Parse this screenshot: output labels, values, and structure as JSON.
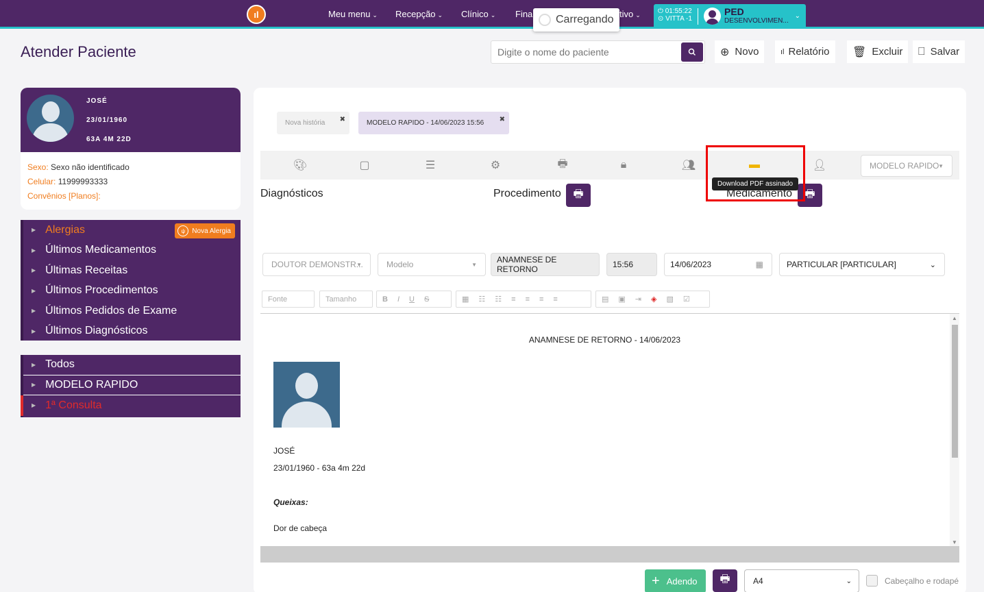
{
  "nav": {
    "items": [
      {
        "label": "Meu menu"
      },
      {
        "label": "Recepção"
      },
      {
        "label": "Clínico"
      },
      {
        "label": "Finan"
      },
      {
        "label": "tivo"
      }
    ],
    "loading": "Carregando",
    "session": {
      "time": "01:55:22",
      "location": "VITTA -1",
      "name": "PED",
      "subtitle": "DESENVOLVIMEN..."
    }
  },
  "header": {
    "title": "Atender Paciente",
    "search_placeholder": "Digite o nome do paciente",
    "novo": "Novo",
    "relatorio": "Relatório",
    "excluir": "Excluir",
    "salvar": "Salvar"
  },
  "patient": {
    "name": "JOSÉ",
    "birth": "23/01/1960",
    "age": "63A 4M 22D",
    "sexo_label": "Sexo:",
    "sexo_value": "Sexo não identificado",
    "celular_label": "Celular:",
    "celular_value": "11999993333",
    "convenios_label": "Convênios [Planos]:"
  },
  "history_panel": {
    "items": [
      {
        "label": "Alergias"
      },
      {
        "label": "Últimos Medicamentos"
      },
      {
        "label": "Últimas Receitas"
      },
      {
        "label": "Últimos Procedimentos"
      },
      {
        "label": "Últimos Pedidos de Exame"
      },
      {
        "label": "Últimos Diagnósticos"
      }
    ],
    "nova_alergia": "Nova Alergia"
  },
  "filter_panel": {
    "items": [
      {
        "label": "Todos"
      },
      {
        "label": "MODELO RAPIDO"
      },
      {
        "label": "1ª Consulta"
      }
    ]
  },
  "tabs": [
    {
      "label": "Nova história"
    },
    {
      "label": "MODELO RAPIDO - 14/06/2023 15:56"
    }
  ],
  "toolbar": {
    "model_select": "MODELO RAPIDO",
    "tooltip": "Download PDF assinado"
  },
  "sections": {
    "diagnosticos": "Diagnósticos",
    "procedimento": "Procedimento",
    "medicamento": "Medicamento"
  },
  "form": {
    "doctor": "DOUTOR DEMONSTR...",
    "modelo_placeholder": "Modelo",
    "anamnese": "ANAMNESE DE RETORNO",
    "time": "15:56",
    "date": "14/06/2023",
    "convenio": "PARTICULAR [PARTICULAR]"
  },
  "editor": {
    "fonte": "Fonte",
    "tamanho": "Tamanho"
  },
  "document": {
    "title": "ANAMNESE DE RETORNO - 14/06/2023",
    "patient_name": "JOSÉ",
    "patient_birth_age": "23/01/1960 - 63a 4m 22d",
    "queixas_label": "Queixas:",
    "queixas_value": "Dor de cabeça"
  },
  "footer": {
    "adendo": "Adendo",
    "paper": "A4",
    "header_footer": "Cabeçalho e rodapé"
  }
}
